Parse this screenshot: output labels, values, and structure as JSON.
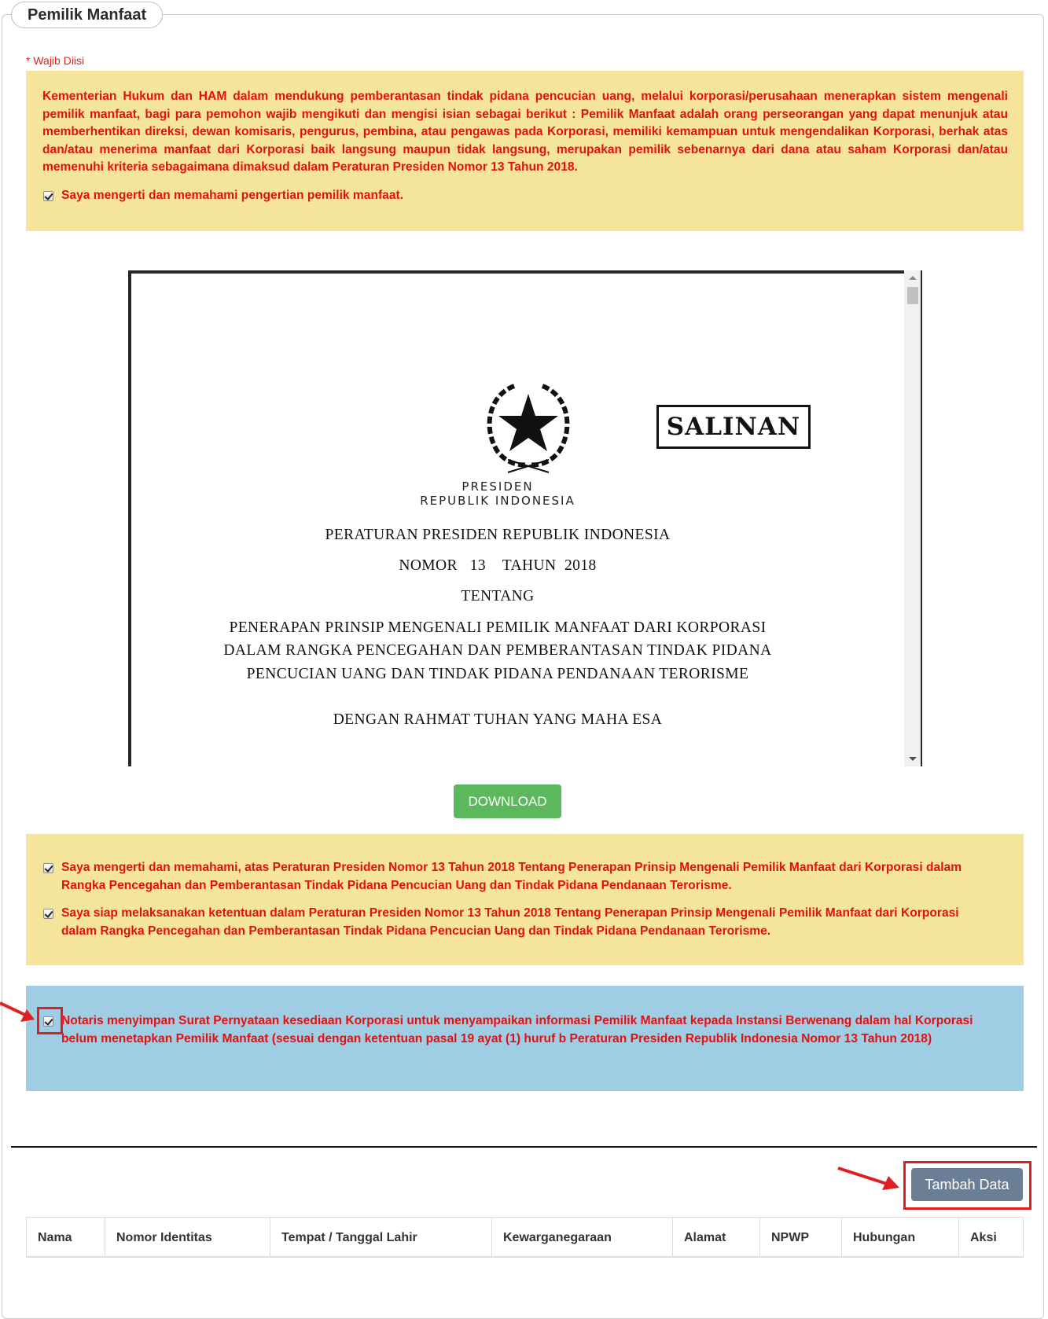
{
  "section": {
    "title": "Pemilik Manfaat",
    "required_note": "* Wajib Diisi"
  },
  "notice_top": {
    "text": "Kementerian Hukum dan HAM dalam mendukung pemberantasan tindak pidana pencucian uang, melalui korporasi/perusahaan menerapkan sistem mengenali pemilik manfaat, bagi para pemohon wajib mengikuti dan mengisi isian sebagai berikut : Pemilik Manfaat adalah orang perseorangan yang dapat menunjuk atau memberhentikan direksi, dewan komisaris, pengurus, pembina, atau pengawas pada Korporasi, memiliki kemampuan untuk mengendalikan Korporasi, berhak atas dan/atau menerima manfaat dari Korporasi baik langsung maupun tidak langsung, merupakan pemilik sebenarnya dari dana atau saham Korporasi dan/atau memenuhi kriteria sebagaimana dimaksud dalam Peraturan Presiden Nomor 13 Tahun 2018.",
    "checkbox_label": "Saya mengerti dan memahami pengertian pemilik manfaat.",
    "checkbox_checked": true
  },
  "document": {
    "stamp": "SALINAN",
    "header_1": "PRESIDEN",
    "header_2": "REPUBLIK INDONESIA",
    "line_1": "PERATURAN PRESIDEN REPUBLIK INDONESIA",
    "line_2": "NOMOR   13    TAHUN  2018",
    "line_3": "TENTANG",
    "line_4": "PENERAPAN PRINSIP MENGENALI PEMILIK MANFAAT DARI KORPORASI",
    "line_5": "DALAM RANGKA PENCEGAHAN DAN PEMBERANTASAN TINDAK PIDANA",
    "line_6": "PENCUCIAN UANG DAN TINDAK PIDANA PENDANAAN TERORISME",
    "line_7": "DENGAN RAHMAT TUHAN YANG MAHA ESA"
  },
  "download_label": "DOWNLOAD",
  "notice_mid": {
    "items": [
      {
        "label": "Saya mengerti dan memahami, atas Peraturan Presiden Nomor 13 Tahun 2018 Tentang Penerapan Prinsip Mengenali Pemilik Manfaat dari Korporasi dalam Rangka Pencegahan dan Pemberantasan Tindak Pidana Pencucian Uang dan Tindak Pidana Pendanaan Terorisme.",
        "checked": true
      },
      {
        "label": "Saya siap melaksanakan ketentuan dalam Peraturan Presiden Nomor 13 Tahun 2018 Tentang Penerapan Prinsip Mengenali Pemilik Manfaat dari Korporasi dalam Rangka Pencegahan dan Pemberantasan Tindak Pidana Pencucian Uang dan Tindak Pidana Pendanaan Terorisme.",
        "checked": true
      }
    ]
  },
  "notice_blue": {
    "label": "Notaris menyimpan Surat Pernyataan kesediaan Korporasi untuk menyampaikan informasi Pemilik Manfaat kepada Instansi Berwenang dalam hal Korporasi belum menetapkan Pemilik Manfaat (sesuai dengan ketentuan pasal 19 ayat (1) huruf b Peraturan Presiden Republik Indonesia Nomor 13 Tahun 2018)",
    "checked": true
  },
  "add_button_label": "Tambah Data",
  "table": {
    "columns": [
      "Nama",
      "Nomor Identitas",
      "Tempat / Tanggal Lahir",
      "Kewarganegaraan",
      "Alamat",
      "NPWP",
      "Hubungan",
      "Aksi"
    ]
  },
  "colors": {
    "notice_yellow": "#f5e59a",
    "notice_blue": "#9fcde4",
    "warning_red": "#e41010",
    "download_green": "#5cb85c",
    "add_button": "#6a7f96",
    "annotation_red": "#e02020"
  }
}
